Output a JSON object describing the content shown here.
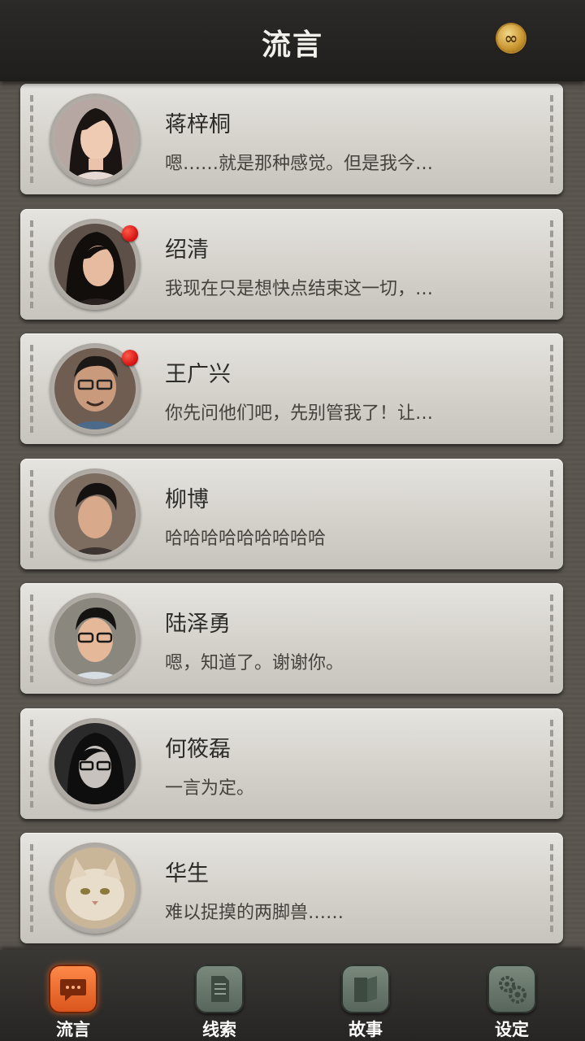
{
  "header": {
    "title": "流言",
    "coin_icon": "infinity-coin-icon",
    "coin_symbol": "∞"
  },
  "contacts": [
    {
      "name": "蒋梓桐",
      "message": "嗯……就是那种感觉。但是我今…",
      "unread": false
    },
    {
      "name": "绍清",
      "message": "我现在只是想快点结束这一切，…",
      "unread": true
    },
    {
      "name": "王广兴",
      "message": "你先问他们吧，先别管我了！让…",
      "unread": true
    },
    {
      "name": "柳博",
      "message": "哈哈哈哈哈哈哈哈哈",
      "unread": false
    },
    {
      "name": "陆泽勇",
      "message": "嗯，知道了。谢谢你。",
      "unread": false
    },
    {
      "name": "何筱磊",
      "message": "一言为定。",
      "unread": false
    },
    {
      "name": "华生",
      "message": "难以捉摸的两脚兽……",
      "unread": false
    }
  ],
  "tabs": [
    {
      "label": "流言",
      "icon": "chat-bubble-icon",
      "active": true
    },
    {
      "label": "线索",
      "icon": "document-icon",
      "active": false
    },
    {
      "label": "故事",
      "icon": "book-icon",
      "active": false
    },
    {
      "label": "设定",
      "icon": "gears-icon",
      "active": false
    }
  ],
  "colors": {
    "unread_dot": "#d40f0f",
    "active_tab": "#e8621f",
    "inactive_tab": "#66756a"
  }
}
